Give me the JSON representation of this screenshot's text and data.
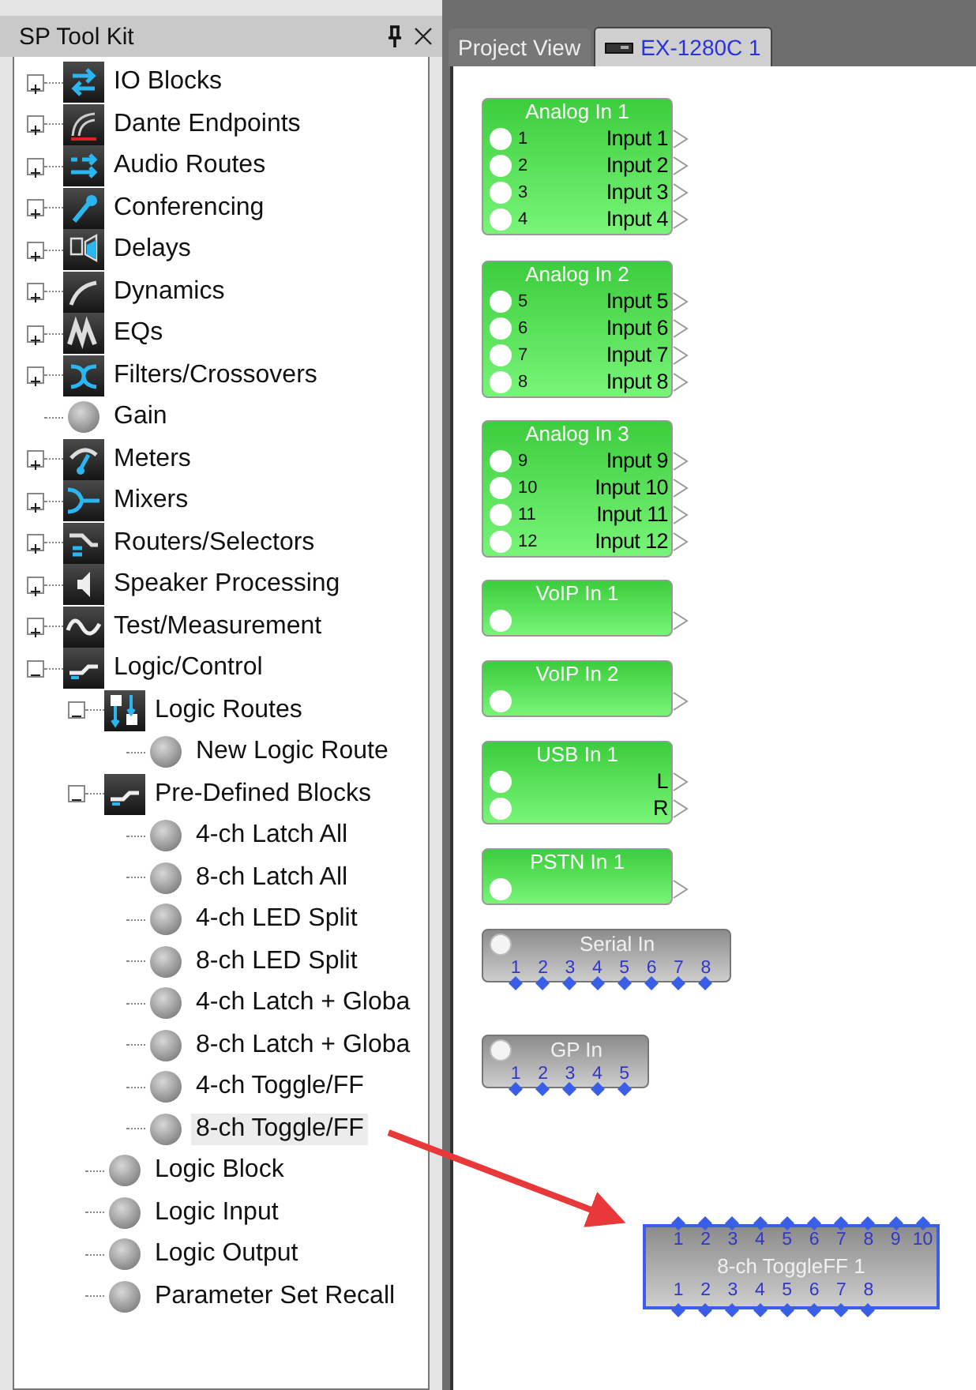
{
  "toolkit": {
    "title": "SP Tool Kit",
    "items": [
      {
        "label": "IO Blocks",
        "expanded": false,
        "selected": false
      },
      {
        "label": "Dante Endpoints",
        "expanded": false,
        "selected": false
      },
      {
        "label": "Audio Routes",
        "expanded": false,
        "selected": false
      },
      {
        "label": "Conferencing",
        "expanded": false,
        "selected": false
      },
      {
        "label": "Delays",
        "expanded": false,
        "selected": false
      },
      {
        "label": "Dynamics",
        "expanded": false,
        "selected": false
      },
      {
        "label": "EQs",
        "expanded": false,
        "selected": false
      },
      {
        "label": "Filters/Crossovers",
        "expanded": false,
        "selected": false
      },
      {
        "label": "Gain",
        "selected": false
      },
      {
        "label": "Meters",
        "expanded": false,
        "selected": false
      },
      {
        "label": "Mixers",
        "expanded": false,
        "selected": false
      },
      {
        "label": "Routers/Selectors",
        "expanded": false,
        "selected": false
      },
      {
        "label": "Speaker Processing",
        "expanded": false,
        "selected": false
      },
      {
        "label": "Test/Measurement",
        "expanded": false,
        "selected": false
      },
      {
        "label": "Logic/Control",
        "expanded": true,
        "selected": false,
        "children": [
          {
            "label": "Logic Routes",
            "expanded": true,
            "selected": false,
            "children": [
              {
                "label": "New Logic Route",
                "selected": false
              }
            ]
          },
          {
            "label": "Pre-Defined Blocks",
            "expanded": true,
            "selected": false,
            "children": [
              {
                "label": "4-ch Latch All",
                "selected": false
              },
              {
                "label": "8-ch Latch All",
                "selected": false
              },
              {
                "label": "4-ch LED Split",
                "selected": false
              },
              {
                "label": "8-ch LED Split",
                "selected": false
              },
              {
                "label": "4-ch Latch + Globa",
                "selected": false
              },
              {
                "label": "8-ch Latch + Globa",
                "selected": false
              },
              {
                "label": "4-ch Toggle/FF",
                "selected": false
              },
              {
                "label": "8-ch Toggle/FF",
                "selected": true
              }
            ]
          },
          {
            "label": "Logic Block",
            "selected": false
          },
          {
            "label": "Logic Input",
            "selected": false
          },
          {
            "label": "Logic Output",
            "selected": false
          },
          {
            "label": "Parameter Set Recall",
            "selected": false
          }
        ]
      }
    ]
  },
  "tabs": [
    {
      "label": "Project View",
      "selected": false
    },
    {
      "label": "EX-1280C 1",
      "selected": true
    }
  ],
  "blocks": [
    {
      "kind": "audio",
      "title": "Analog In 1",
      "rows": [
        {
          "number": "1",
          "label": "Input 1"
        },
        {
          "number": "2",
          "label": "Input 2"
        },
        {
          "number": "3",
          "label": "Input 3"
        },
        {
          "number": "4",
          "label": "Input 4"
        }
      ]
    },
    {
      "kind": "audio",
      "title": "Analog In 2",
      "rows": [
        {
          "number": "5",
          "label": "Input 5"
        },
        {
          "number": "6",
          "label": "Input 6"
        },
        {
          "number": "7",
          "label": "Input 7"
        },
        {
          "number": "8",
          "label": "Input 8"
        }
      ]
    },
    {
      "kind": "audio",
      "title": "Analog In 3",
      "rows": [
        {
          "number": "9",
          "label": "Input 9"
        },
        {
          "number": "10",
          "label": "Input 10"
        },
        {
          "number": "11",
          "label": "Input 11"
        },
        {
          "number": "12",
          "label": "Input 12"
        }
      ]
    },
    {
      "kind": "audio",
      "title": "VoIP In 1",
      "rows": [
        {
          "output": true
        }
      ]
    },
    {
      "kind": "audio",
      "title": "VoIP In 2",
      "rows": [
        {
          "output": true
        }
      ]
    },
    {
      "kind": "audio",
      "title": "USB In 1",
      "rows": [
        {
          "label": "L"
        },
        {
          "label": "R"
        }
      ]
    },
    {
      "kind": "audio",
      "title": "PSTN In 1",
      "rows": [
        {
          "output": true
        }
      ]
    },
    {
      "kind": "logic",
      "title": "Serial In",
      "led": true,
      "selected": false,
      "bottom_pins": [
        "1",
        "2",
        "3",
        "4",
        "5",
        "6",
        "7",
        "8"
      ]
    },
    {
      "kind": "logic",
      "title": "GP In",
      "led": true,
      "selected": false,
      "bottom_pins": [
        "1",
        "2",
        "3",
        "4",
        "5"
      ]
    },
    {
      "kind": "logic",
      "title": "8-ch ToggleFF 1",
      "led": false,
      "selected": true,
      "top_pins": [
        "1",
        "2",
        "3",
        "4",
        "5",
        "6",
        "7",
        "8",
        "9",
        "10"
      ],
      "bottom_pins": [
        "1",
        "2",
        "3",
        "4",
        "5",
        "6",
        "7",
        "8"
      ]
    }
  ]
}
